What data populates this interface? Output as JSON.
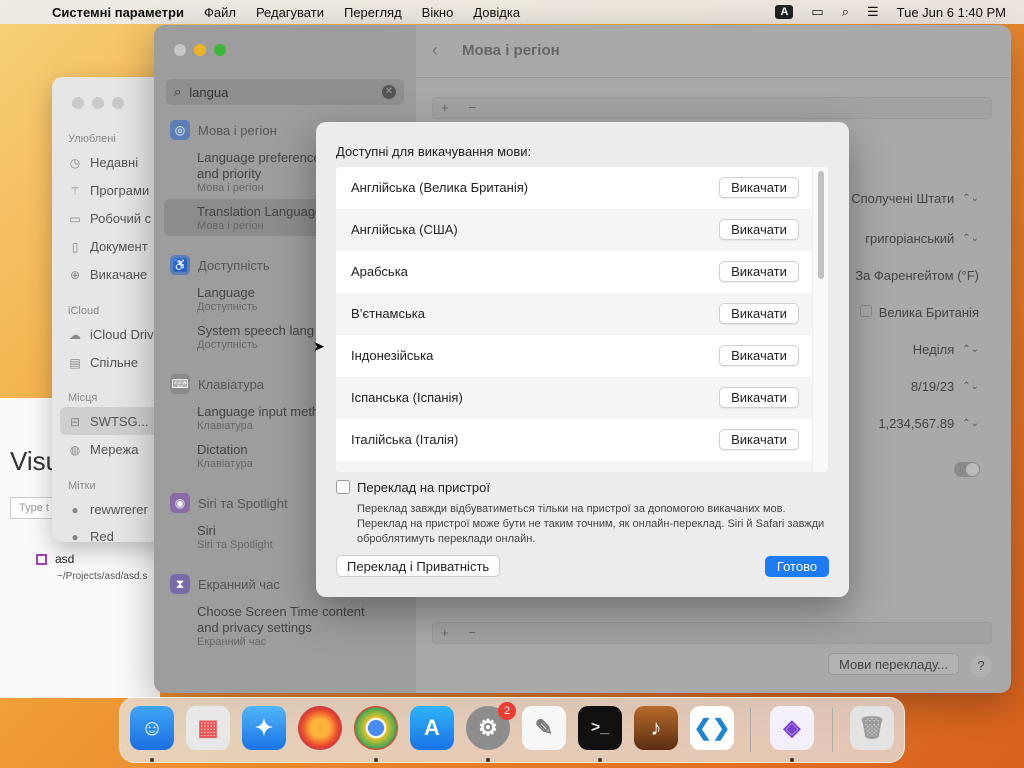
{
  "menubar": {
    "app_name": "Системні параметри",
    "items": [
      "Файл",
      "Редагувати",
      "Перегляд",
      "Вікно",
      "Довідка"
    ],
    "input_indicator": "A",
    "date_time": "Tue Jun 6  1:40 PM"
  },
  "finder": {
    "favorites_header": "Улюблені",
    "favorites": [
      "Недавні",
      "Програми",
      "Робочий с",
      "Документ",
      "Викачане"
    ],
    "icloud_header": "iCloud",
    "icloud": [
      "iCloud Driv",
      "Спільне"
    ],
    "places_header": "Місця",
    "places": [
      "SWTSG...",
      "Мережа"
    ],
    "tags_header": "Мітки",
    "tags": [
      "rewwrerer",
      "Red"
    ]
  },
  "vscode": {
    "title": "Visu",
    "search_placeholder": "Type t",
    "recent_name": "asd",
    "recent_path": "~/Projects/asd/asd.s"
  },
  "settings": {
    "title": "Мова і регіон",
    "search_value": "langua",
    "sidebar": {
      "cat_language": "Мова і регіон",
      "sub1_title": "Language preference",
      "sub1_title2": "and priority",
      "sub1_hint": "Мова і регіон",
      "sub2_title": "Translation Languages",
      "sub2_hint": "Мова і регіон",
      "cat_access": "Доступність",
      "sub3_title": "Language",
      "sub3_hint": "Доступність",
      "sub4_title": "System speech lang",
      "sub4_hint": "Доступність",
      "cat_keyboard": "Клавіатура",
      "sub5_title": "Language input meth",
      "sub5_hint": "Клавіатура",
      "sub6_title": "Dictation",
      "sub6_hint": "Клавіатура",
      "cat_siri": "Siri та Spotlight",
      "sub7_title": "Siri",
      "sub7_hint": "Siri та Spotlight",
      "cat_screen": "Екранний час",
      "sub8_title": "Choose Screen Time content",
      "sub8_title2": "and privacy settings",
      "sub8_hint": "Екранний час"
    },
    "rows": {
      "region": "Сполучені Штати",
      "calendar": "григоріанський",
      "temperature": "За Фаренгейтом (°F)",
      "measurement": "Велика Британія",
      "first_day": "Неділя",
      "date_format": "8/19/23",
      "number_format": "1,234,567.89"
    },
    "plus_minus": "+ −",
    "translation_button": "Мови перекладу...",
    "help": "?"
  },
  "dialog": {
    "title": "Доступні для викачування мови:",
    "download_label": "Викачати",
    "languages": [
      "Англійська (Велика Британія)",
      "Англійська (США)",
      "Арабська",
      "В’єтнамська",
      "Індонезійська",
      "Іспанська (Іспанія)",
      "Італійська (Італія)"
    ],
    "on_device_label": "Переклад на пристрої",
    "description": "Переклад завжди відбуватиметься тільки на пристрої за допомогою викачаних мов. Переклад на пристрої може бути не таким точним, як онлайн-переклад. Siri й Safari завжди оброблятимуть переклади онлайн.",
    "privacy_button": "Переклад і Приватність",
    "done_button": "Готово"
  },
  "dock": {
    "settings_badge": "2"
  }
}
